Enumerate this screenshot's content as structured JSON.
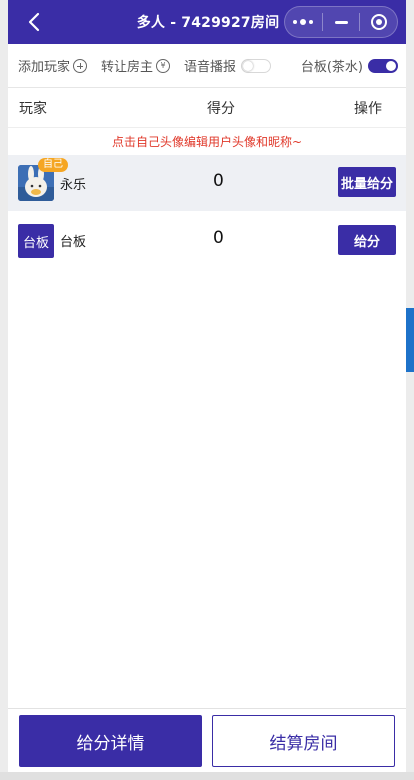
{
  "header": {
    "title": "多人 - 7429927房间",
    "back_icon": "chevron-left-icon",
    "capsule_icons": [
      "more-dots-icon",
      "minimize-icon",
      "close-target-icon"
    ]
  },
  "toolbar": {
    "add_player": "添加玩家",
    "transfer_owner": "转让房主",
    "voice_broadcast": "语音播报",
    "voice_broadcast_on": false,
    "table_fee": "台板(茶水)",
    "table_fee_on": true
  },
  "table_header": {
    "player": "玩家",
    "score": "得分",
    "action": "操作"
  },
  "hint": "点击自己头像编辑用户头像和昵称~",
  "players": [
    {
      "badge": "自己",
      "name": "永乐",
      "score": "0",
      "action": "批量给分"
    },
    {
      "avatar_label": "台板",
      "name": "台板",
      "score": "0",
      "action": "给分"
    }
  ],
  "footer": {
    "details": "给分详情",
    "settle": "结算房间"
  },
  "colors": {
    "primary": "#3a2da6",
    "hint": "#e0382a",
    "badge": "#f5a623"
  }
}
